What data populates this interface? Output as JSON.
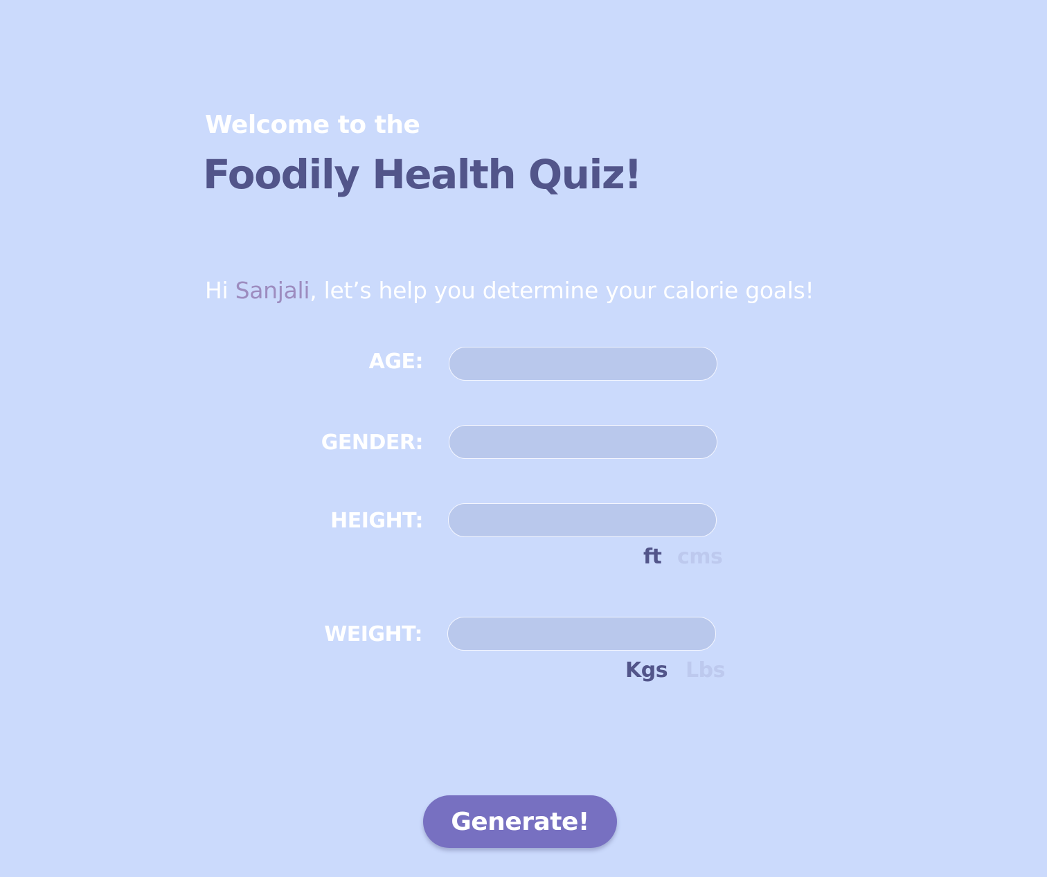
{
  "header": {
    "welcome": "Welcome to the",
    "title": "Foodily Health Quiz!"
  },
  "greeting": {
    "prefix": "Hi ",
    "name": "Sanjali",
    "suffix": ", let’s help you determine your calorie goals!"
  },
  "form": {
    "age": {
      "label": "AGE:",
      "value": ""
    },
    "gender": {
      "label": "GENDER:",
      "value": ""
    },
    "height": {
      "label": "HEIGHT:",
      "value": "",
      "units": [
        {
          "label": "ft",
          "selected": true
        },
        {
          "label": "cms",
          "selected": false
        }
      ]
    },
    "weight": {
      "label": "WEIGHT:",
      "value": "",
      "units": [
        {
          "label": "Kgs",
          "selected": true
        },
        {
          "label": "Lbs",
          "selected": false
        }
      ]
    }
  },
  "actions": {
    "generate_label": "Generate!"
  },
  "colors": {
    "background": "#cbdafc",
    "title": "#52558a",
    "accent_name": "#9d8cbf",
    "input_fill": "#b9c8ec",
    "button": "#7770c1",
    "unit_inactive": "#bdc9ee"
  }
}
